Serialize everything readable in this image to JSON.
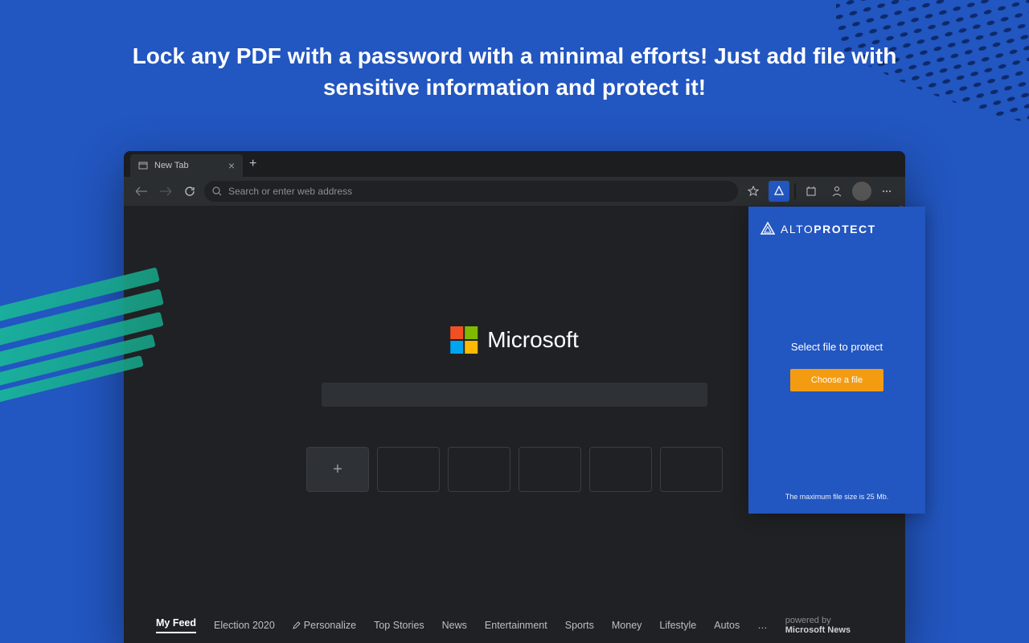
{
  "hero": "Lock any PDF with a password with a minimal efforts! Just add file with sensitive information and protect it!",
  "browser": {
    "tab": {
      "label": "New Tab"
    },
    "address": {
      "placeholder": "Search or enter web address"
    },
    "content": {
      "brand": "Microsoft",
      "tiles_add": "+",
      "feed": {
        "items": [
          "My Feed",
          "Election 2020",
          "Personalize",
          "Top Stories",
          "News",
          "Entertainment",
          "Sports",
          "Money",
          "Lifestyle",
          "Autos"
        ],
        "more": "…",
        "powered_prefix": "powered by ",
        "powered_brand": "Microsoft News"
      }
    }
  },
  "popup": {
    "brand_prefix": "ALTO",
    "brand_suffix": "PROTECT",
    "title": "Select file to protect",
    "button": "Choose a file",
    "footer": "The maximum file size is 25 Mb."
  }
}
